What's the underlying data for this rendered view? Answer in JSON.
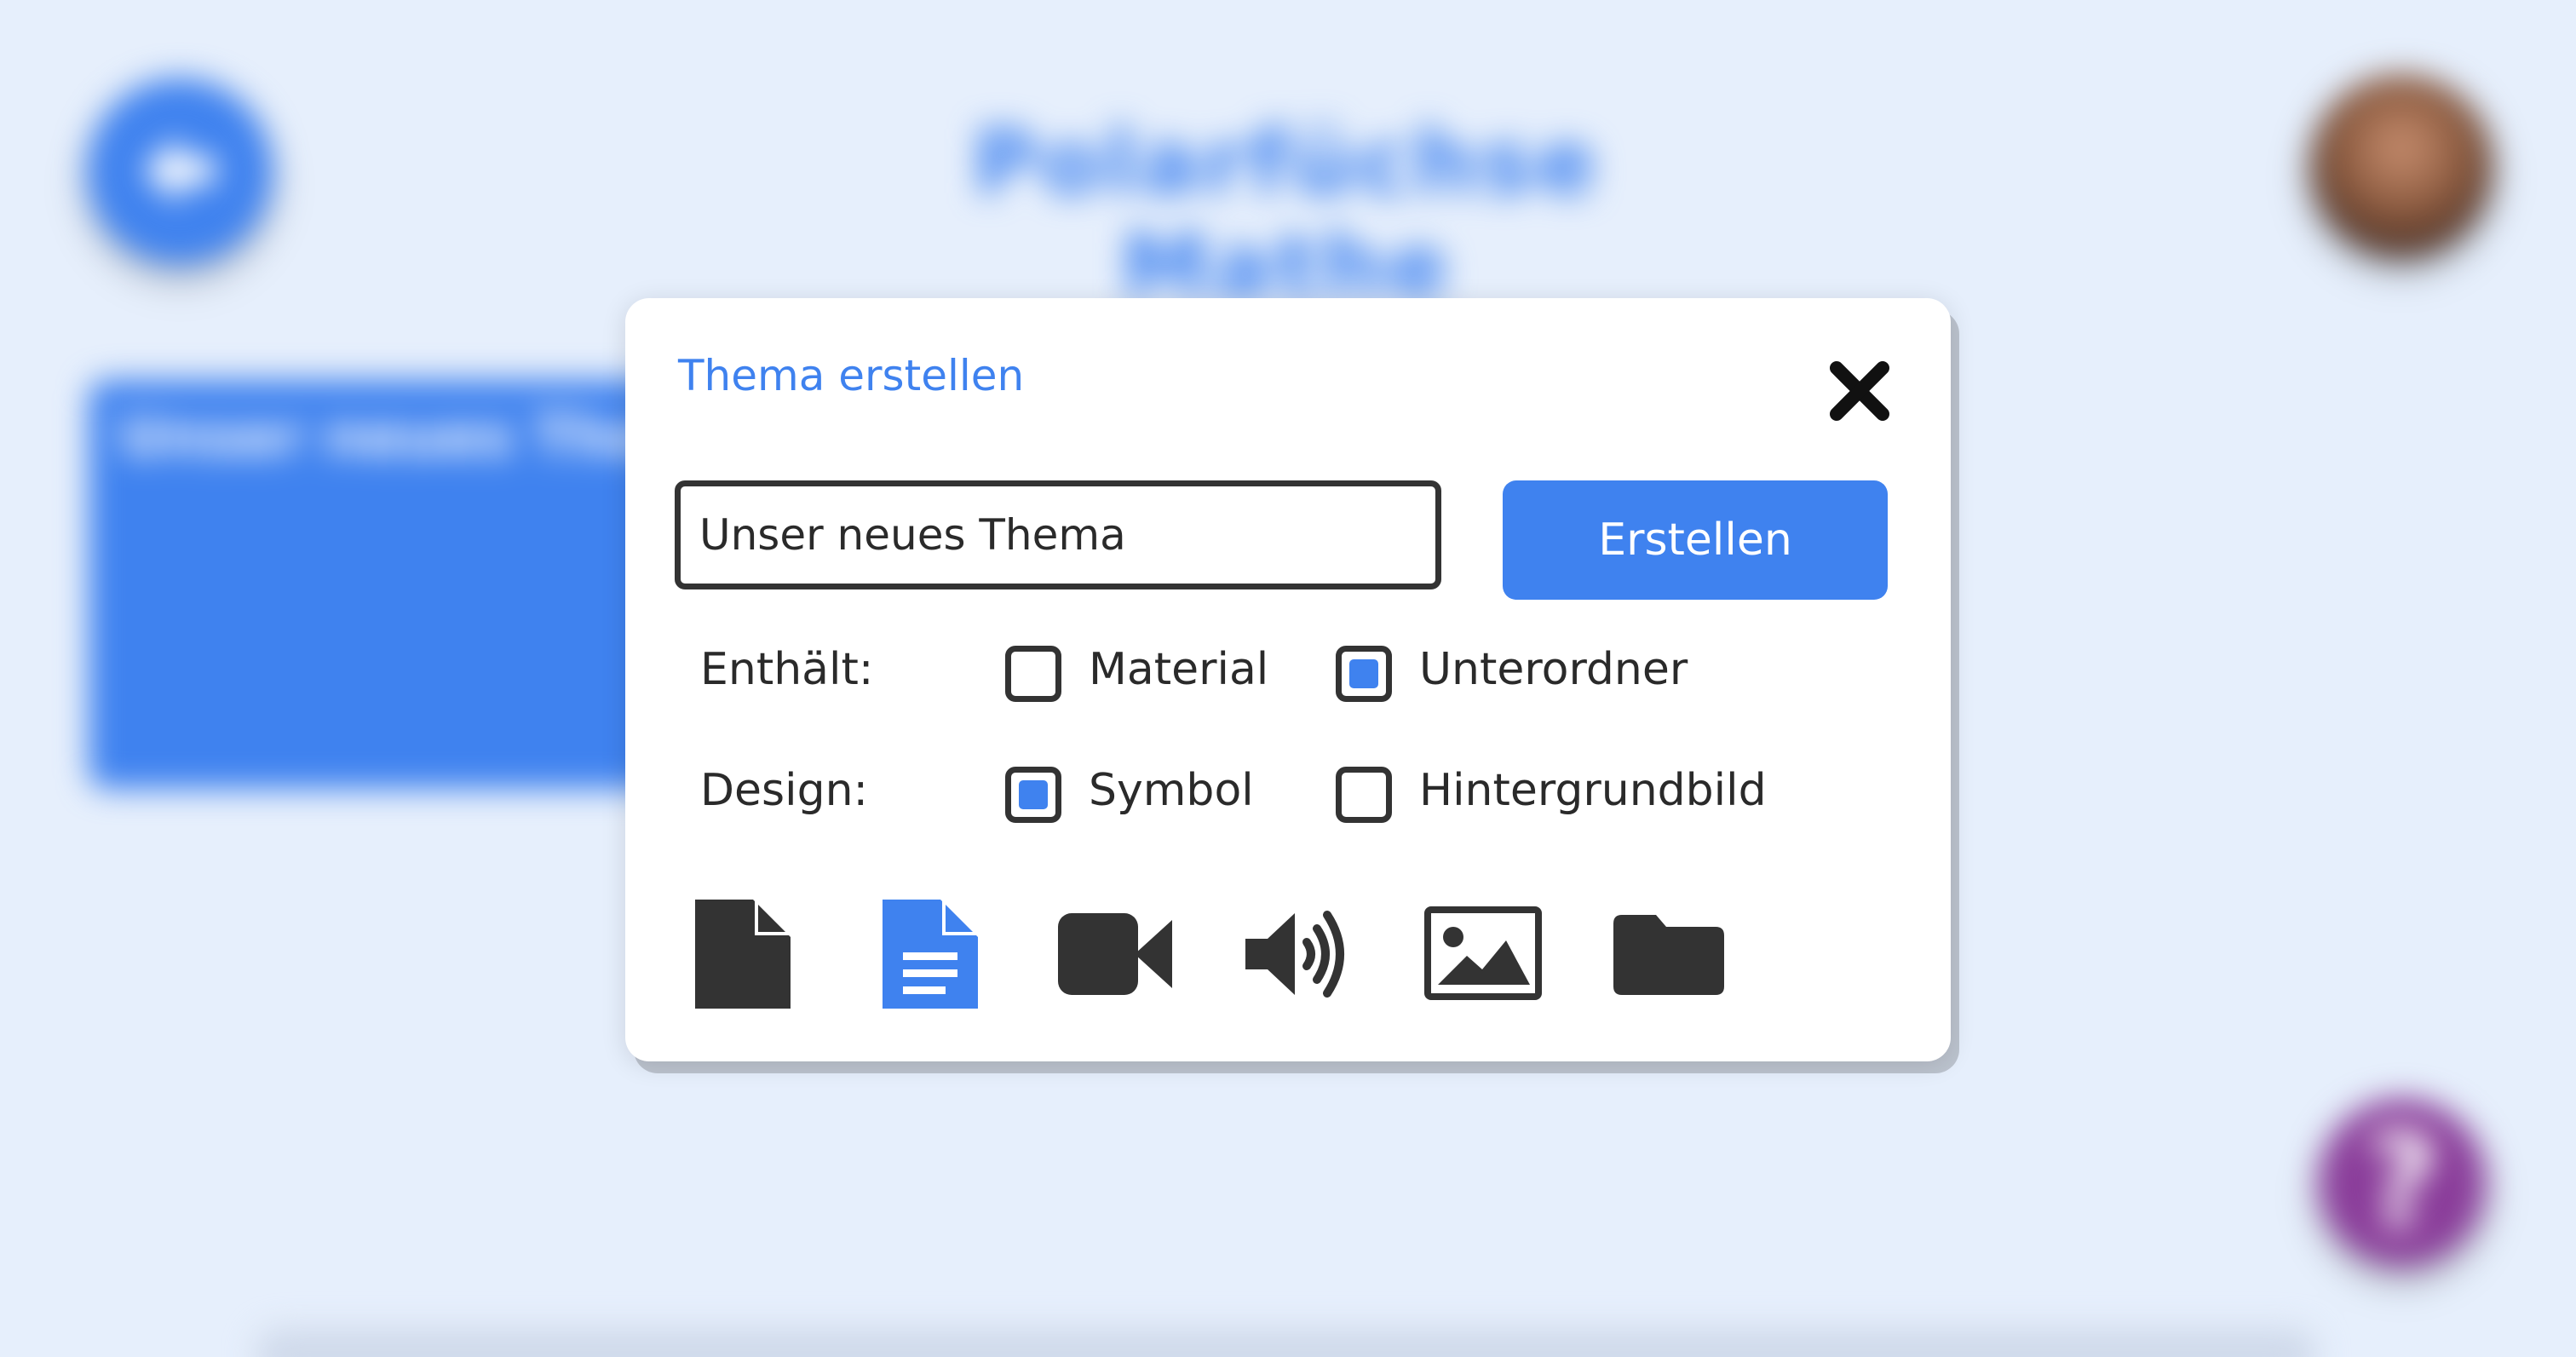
{
  "background": {
    "title": "Polarfüchse Mathe",
    "card_title": "Unser neues Thema"
  },
  "dialog": {
    "title": "Thema erstellen",
    "name_input_value": "Unser neues Thema",
    "create_label": "Erstellen",
    "contains_label": "Enthält:",
    "design_label": "Design:",
    "options": {
      "material": {
        "label": "Material",
        "checked": false
      },
      "unterordner": {
        "label": "Unterordner",
        "checked": true
      },
      "symbol": {
        "label": "Symbol",
        "checked": true
      },
      "hintergrundbild": {
        "label": "Hintergrundbild",
        "checked": false
      }
    },
    "icons": [
      "file-icon",
      "document-icon",
      "video-camera-icon",
      "speaker-icon",
      "image-icon",
      "folder-icon"
    ],
    "selected_icon": "document-icon"
  },
  "colors": {
    "accent": "#3f82ef",
    "dark": "#333333",
    "help": "#8a3c9a",
    "background": "#e6effc"
  }
}
